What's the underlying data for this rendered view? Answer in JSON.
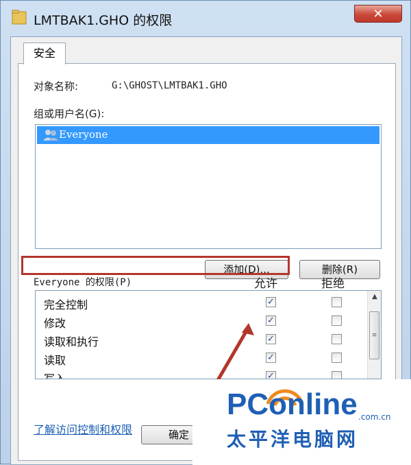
{
  "window": {
    "title": "LMTBAK1.GHO 的权限",
    "close_label": "✕"
  },
  "tab": {
    "label": "安全"
  },
  "object": {
    "label": "对象名称:",
    "value": "G:\\GHOST\\LMTBAK1.GHO"
  },
  "groups": {
    "label": "组或用户名(G):",
    "items": [
      {
        "name": "Everyone",
        "selected": true
      }
    ]
  },
  "buttons": {
    "add": "添加(D)...",
    "remove": "删除(R)",
    "ok": "确定"
  },
  "permissions": {
    "title": "Everyone 的权限(P)",
    "allow_header": "允许",
    "deny_header": "拒绝",
    "rows": [
      {
        "name": "完全控制",
        "allow": true,
        "deny": false
      },
      {
        "name": "修改",
        "allow": true,
        "deny": false
      },
      {
        "name": "读取和执行",
        "allow": true,
        "deny": false
      },
      {
        "name": "读取",
        "allow": true,
        "deny": false
      },
      {
        "name": "写入",
        "allow": true,
        "deny": false
      }
    ]
  },
  "link": {
    "text": "了解访问控制和权限"
  },
  "watermark": {
    "brand": "PConline",
    "domain": ".com.cn",
    "cn_name": "太平洋电脑网"
  },
  "colors": {
    "selection": "#3399ff",
    "highlight": "#b3362b",
    "brand": "#1f5fb5"
  }
}
